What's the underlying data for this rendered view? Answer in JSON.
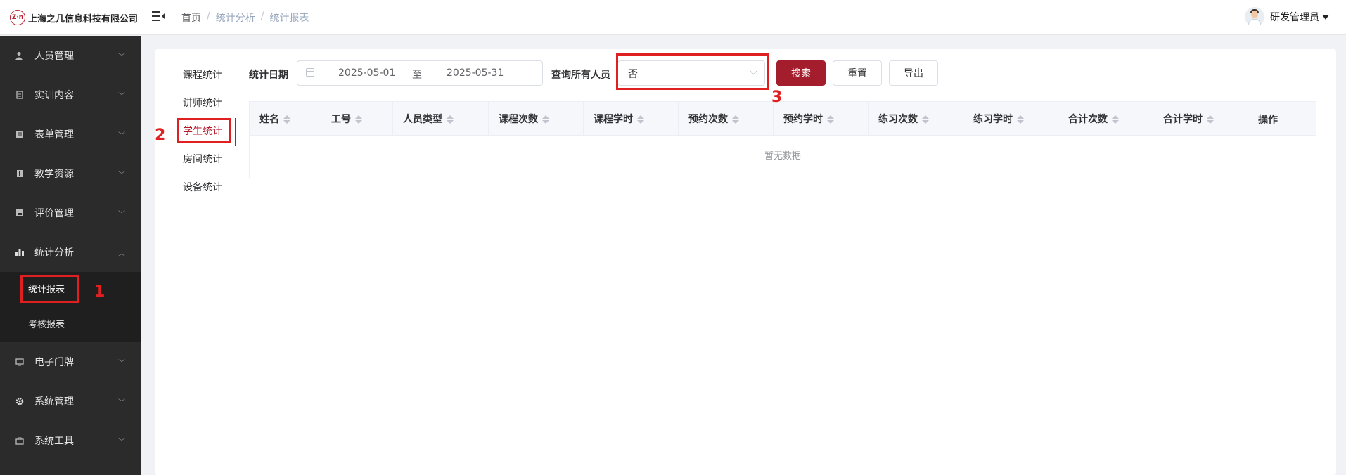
{
  "header": {
    "company": "上海之几信息科技有限公司",
    "logo_mark": "Z·n",
    "breadcrumb": [
      "首页",
      "统计分析",
      "统计报表"
    ],
    "user_name": "研发管理员"
  },
  "sidebar": {
    "items": [
      {
        "label": "人员管理",
        "icon": "user-icon"
      },
      {
        "label": "实训内容",
        "icon": "document-icon"
      },
      {
        "label": "表单管理",
        "icon": "form-icon"
      },
      {
        "label": "教学资源",
        "icon": "book-icon"
      },
      {
        "label": "评价管理",
        "icon": "evaluation-icon"
      },
      {
        "label": "统计分析",
        "icon": "bar-chart-icon"
      },
      {
        "label": "电子门牌",
        "icon": "monitor-icon"
      },
      {
        "label": "系统管理",
        "icon": "gear-icon"
      },
      {
        "label": "系统工具",
        "icon": "toolbox-icon"
      }
    ],
    "submenu": [
      "统计报表",
      "考核报表"
    ]
  },
  "tabs": [
    "课程统计",
    "讲师统计",
    "学生统计",
    "房间统计",
    "设备统计"
  ],
  "filters": {
    "date_label": "统计日期",
    "date_start": "2025-05-01",
    "date_sep": "至",
    "date_end": "2025-05-31",
    "all_label": "查询所有人员",
    "all_value": "否",
    "search_btn": "搜索",
    "reset_btn": "重置",
    "export_btn": "导出"
  },
  "table": {
    "columns": [
      "姓名",
      "工号",
      "人员类型",
      "课程次数",
      "课程学时",
      "预约次数",
      "预约学时",
      "练习次数",
      "练习学时",
      "合计次数",
      "合计学时",
      "操作"
    ],
    "empty_text": "暂无数据"
  },
  "annotations": [
    "1",
    "2",
    "3"
  ],
  "colors": {
    "accent": "#a31d2c",
    "sidebar_bg": "#2b2b2b",
    "annotation": "#e02020"
  }
}
